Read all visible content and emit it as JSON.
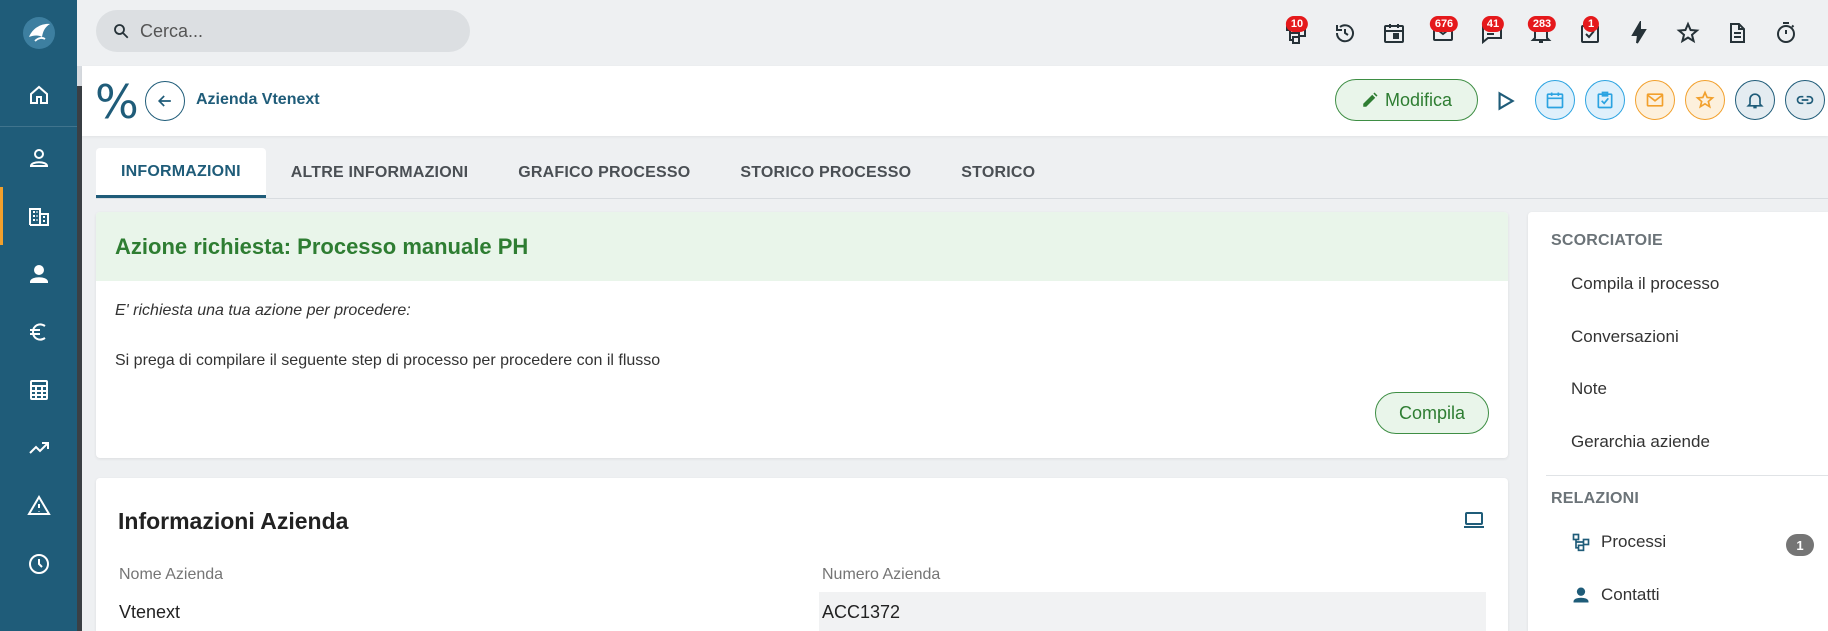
{
  "search": {
    "placeholder": "Cerca..."
  },
  "topbar": {
    "icons": [
      {
        "name": "processes-icon",
        "badge": "10"
      },
      {
        "name": "history-icon",
        "badge": ""
      },
      {
        "name": "calendar-icon",
        "badge": ""
      },
      {
        "name": "mail-icon",
        "badge": "676"
      },
      {
        "name": "chat-icon",
        "badge": "41"
      },
      {
        "name": "bell-icon",
        "badge": "283"
      },
      {
        "name": "tasks-icon",
        "badge": "1"
      },
      {
        "name": "flash-icon",
        "badge": ""
      },
      {
        "name": "star-icon",
        "badge": ""
      },
      {
        "name": "document-icon",
        "badge": ""
      },
      {
        "name": "timer-icon",
        "badge": ""
      }
    ],
    "badge_color": "#e5191c"
  },
  "header": {
    "module_symbol": "%",
    "record_title": "Azienda Vtenext",
    "edit_label": "Modifica"
  },
  "tabs": [
    {
      "label": "INFORMAZIONI",
      "active": true
    },
    {
      "label": "ALTRE INFORMAZIONI",
      "active": false
    },
    {
      "label": "GRAFICO PROCESSO",
      "active": false
    },
    {
      "label": "STORICO PROCESSO",
      "active": false
    },
    {
      "label": "STORICO",
      "active": false
    }
  ],
  "action": {
    "title": "Azione richiesta: Processo manuale PH",
    "subtitle": "E' richiesta una tua azione per procedere:",
    "text": "Si prega di compilare il seguente step di processo per procedere con il flusso",
    "button_label": "Compila"
  },
  "info": {
    "title": "Informazioni Azienda",
    "fields": [
      {
        "label": "Nome Azienda",
        "value": "Vtenext"
      },
      {
        "label": "Numero Azienda",
        "value": "ACC1372"
      }
    ]
  },
  "side": {
    "shortcuts_title": "SCORCIATOIE",
    "shortcuts": [
      "Compila il processo",
      "Conversazioni",
      "Note",
      "Gerarchia aziende"
    ],
    "relations_title": "RELAZIONI",
    "relations": [
      {
        "label": "Processi",
        "count": "1"
      },
      {
        "label": "Contatti",
        "count": ""
      }
    ]
  },
  "colors": {
    "sidebar": "#1f5c79",
    "accent_green": "#2e7d32",
    "accent_orange": "#f2a02c",
    "accent_blue": "#2ba3e1"
  }
}
